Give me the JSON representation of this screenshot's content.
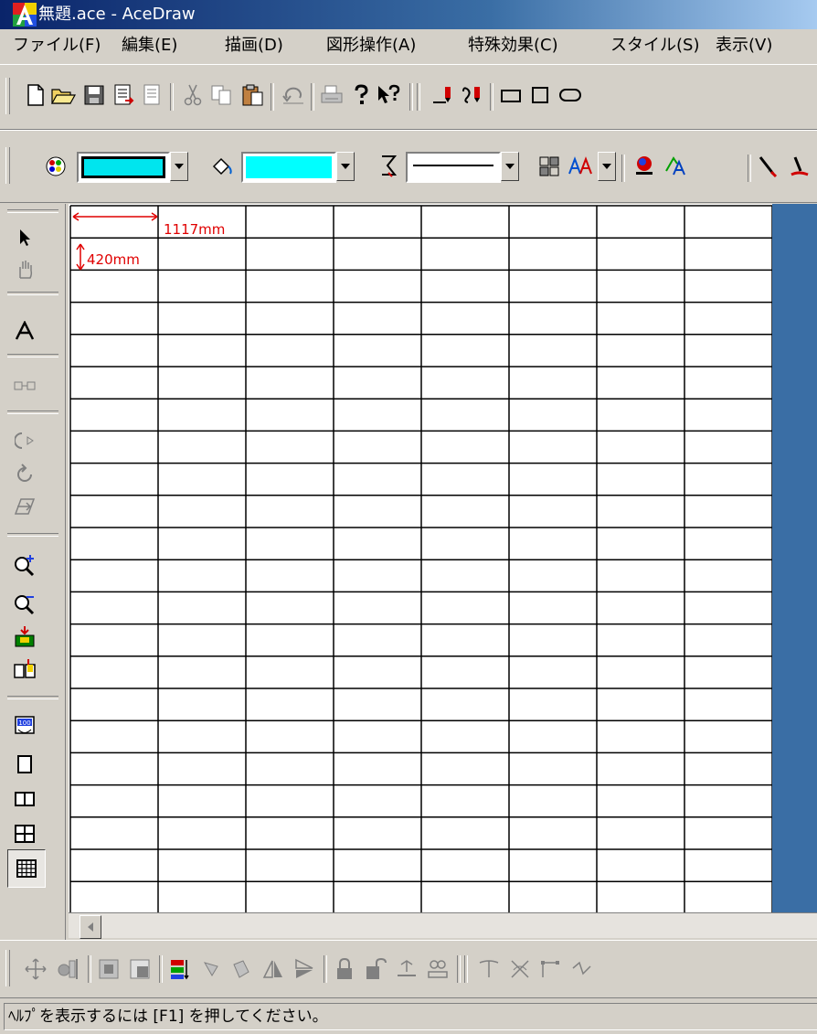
{
  "window": {
    "title": "無題.ace - AceDraw"
  },
  "menu": [
    {
      "label": "ファイル(F)",
      "key": "file"
    },
    {
      "label": "編集(E)",
      "key": "edit"
    },
    {
      "label": "描画(D)",
      "key": "draw"
    },
    {
      "label": "図形操作(A)",
      "key": "shape-ops"
    },
    {
      "label": "特殊効果(C)",
      "key": "effects"
    },
    {
      "label": "スタイル(S)",
      "key": "style"
    },
    {
      "label": "表示(V)",
      "key": "view"
    }
  ],
  "toolbar_standard": {
    "icons": [
      "new-file-icon",
      "open-folder-icon",
      "save-icon",
      "save-as-icon",
      "export-icon",
      "cut-icon",
      "copy-icon",
      "paste-icon",
      "undo-icon",
      "print-icon",
      "help-icon",
      "context-help-icon",
      "line-tool-icon",
      "curve-tool-icon",
      "rectangle-tool-icon",
      "square-tool-icon",
      "rounded-rect-tool-icon"
    ]
  },
  "toolbar_style": {
    "line_color": "#00e5ee",
    "fill_color": "#00ffff",
    "icons": [
      "line-color-icon",
      "fill-color-icon",
      "line-style-icon",
      "pattern-icon",
      "font-style-icon",
      "shadow-icon",
      "text-effect-icon",
      "pen-icon",
      "pen-red-icon"
    ]
  },
  "palette": {
    "icons": [
      "select-arrow-icon",
      "hand-pan-icon",
      "text-tool-icon",
      "connector-icon",
      "rotate-free-icon",
      "rotate-icon",
      "skew-icon",
      "zoom-in-icon",
      "zoom-out-icon",
      "fit-page-icon",
      "fit-width-icon",
      "zoom-100-icon",
      "single-page-icon",
      "two-page-icon",
      "four-page-icon",
      "grid-page-icon"
    ]
  },
  "canvas": {
    "annotation_width": "1117mm",
    "annotation_height": "420mm",
    "grid_columns": 8,
    "grid_rows": 22
  },
  "status": {
    "text": "ﾍﾙﾌﾟを表示するには [F1] を押してください。"
  }
}
